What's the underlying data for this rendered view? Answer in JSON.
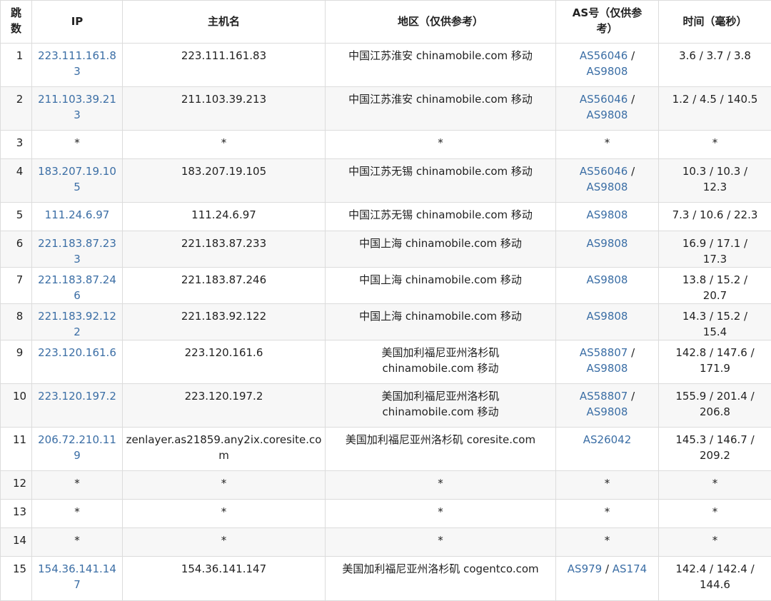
{
  "headers": {
    "hop": "跳\n数",
    "ip": "IP",
    "hostname": "主机名",
    "region": "地区（仅供参考）",
    "asn": "AS号（仅供参考）",
    "time": "时间（毫秒）"
  },
  "rows": [
    {
      "hop": "1",
      "ip": "223.111.161.83",
      "host": "223.111.161.83",
      "region": "中国江苏淮安 chinamobile.com 移动",
      "as": [
        "AS56046",
        "AS9808"
      ],
      "time": "3.6 / 3.7 / 3.8"
    },
    {
      "hop": "2",
      "ip": "211.103.39.213",
      "host": "211.103.39.213",
      "region": "中国江苏淮安 chinamobile.com 移动",
      "as": [
        "AS56046",
        "AS9808"
      ],
      "time": "1.2 / 4.5 / 140.5"
    },
    {
      "hop": "3",
      "ip": "*",
      "host": "*",
      "region": "*",
      "as": [
        "*"
      ],
      "time": "*"
    },
    {
      "hop": "4",
      "ip": "183.207.19.105",
      "host": "183.207.19.105",
      "region": "中国江苏无锡 chinamobile.com 移动",
      "as": [
        "AS56046",
        "AS9808"
      ],
      "time": "10.3 / 10.3 / 12.3"
    },
    {
      "hop": "5",
      "ip": "111.24.6.97",
      "host": "111.24.6.97",
      "region": "中国江苏无锡 chinamobile.com 移动",
      "as": [
        "AS9808"
      ],
      "time": "7.3 / 10.6 / 22.3"
    },
    {
      "hop": "6",
      "ip": "221.183.87.233",
      "host": "221.183.87.233",
      "region": "中国上海 chinamobile.com 移动",
      "as": [
        "AS9808"
      ],
      "time": "16.9 / 17.1 / 17.3"
    },
    {
      "hop": "7",
      "ip": "221.183.87.246",
      "host": "221.183.87.246",
      "region": "中国上海 chinamobile.com 移动",
      "as": [
        "AS9808"
      ],
      "time": "13.8 / 15.2 / 20.7"
    },
    {
      "hop": "8",
      "ip": "221.183.92.122",
      "host": "221.183.92.122",
      "region": "中国上海 chinamobile.com 移动",
      "as": [
        "AS9808"
      ],
      "time": "14.3 / 15.2 / 15.4"
    },
    {
      "hop": "9",
      "ip": "223.120.161.6",
      "host": "223.120.161.6",
      "region": "美国加利福尼亚州洛杉矶 chinamobile.com 移动",
      "as": [
        "AS58807",
        "AS9808"
      ],
      "time": "142.8 / 147.6 / 171.9"
    },
    {
      "hop": "10",
      "ip": "223.120.197.2",
      "host": "223.120.197.2",
      "region": "美国加利福尼亚州洛杉矶 chinamobile.com 移动",
      "as": [
        "AS58807",
        "AS9808"
      ],
      "time": "155.9 / 201.4 / 206.8"
    },
    {
      "hop": "11",
      "ip": "206.72.210.119",
      "host": "zenlayer.as21859.any2ix.coresite.com",
      "region": "美国加利福尼亚州洛杉矶 coresite.com",
      "as": [
        "AS26042"
      ],
      "time": "145.3 / 146.7 / 209.2"
    },
    {
      "hop": "12",
      "ip": "*",
      "host": "*",
      "region": "*",
      "as": [
        "*"
      ],
      "time": "*"
    },
    {
      "hop": "13",
      "ip": "*",
      "host": "*",
      "region": "*",
      "as": [
        "*"
      ],
      "time": "*"
    },
    {
      "hop": "14",
      "ip": "*",
      "host": "*",
      "region": "*",
      "as": [
        "*"
      ],
      "time": "*"
    },
    {
      "hop": "15",
      "ip": "154.36.141.147",
      "host": "154.36.141.147",
      "region": "美国加利福尼亚州洛杉矶 cogentco.com",
      "as": [
        "AS979",
        "AS174"
      ],
      "time": "142.4 / 142.4 / 144.6"
    }
  ],
  "separator": " / ",
  "colors": {
    "link": "#3b6ea5",
    "border": "#dcdcdc",
    "text": "#222222"
  }
}
